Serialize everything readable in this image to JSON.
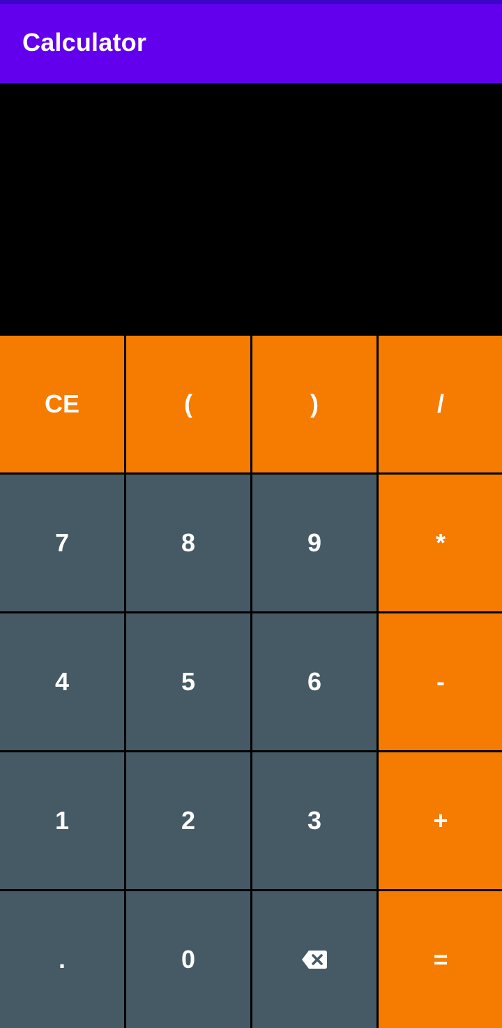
{
  "app_bar": {
    "title": "Calculator",
    "color": "#6200ee"
  },
  "display": {
    "expression": ""
  },
  "keypad": {
    "operator_color": "#f57c00",
    "number_color": "#455a64",
    "keys": [
      {
        "label": "CE"
      },
      {
        "label": "("
      },
      {
        "label": ")"
      },
      {
        "label": "/"
      },
      {
        "label": "7"
      },
      {
        "label": "8"
      },
      {
        "label": "9"
      },
      {
        "label": "*"
      },
      {
        "label": "4"
      },
      {
        "label": "5"
      },
      {
        "label": "6"
      },
      {
        "label": "-"
      },
      {
        "label": "1"
      },
      {
        "label": "2"
      },
      {
        "label": "3"
      },
      {
        "label": "+"
      },
      {
        "label": "."
      },
      {
        "label": "0"
      },
      {
        "icon": "backspace-icon"
      },
      {
        "label": "="
      }
    ]
  }
}
